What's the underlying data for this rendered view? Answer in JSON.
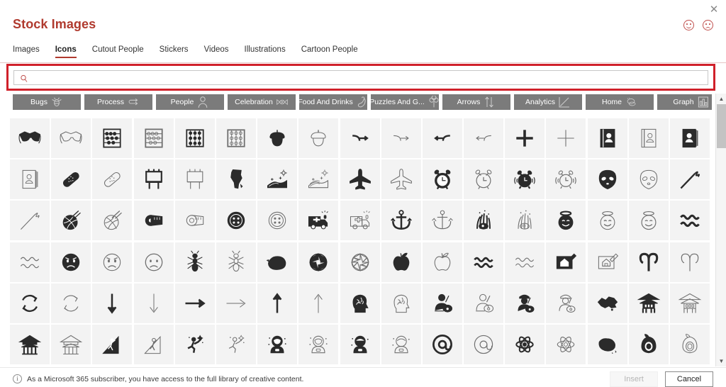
{
  "window": {
    "title": "Stock Images",
    "close_label": "✕",
    "feedback": [
      {
        "name": "smile-feedback",
        "label": "☺"
      },
      {
        "name": "frown-feedback",
        "label": "☹"
      }
    ]
  },
  "tabs": [
    {
      "label": "Images",
      "active": false
    },
    {
      "label": "Icons",
      "active": true
    },
    {
      "label": "Cutout People",
      "active": false
    },
    {
      "label": "Stickers",
      "active": false
    },
    {
      "label": "Videos",
      "active": false
    },
    {
      "label": "Illustrations",
      "active": false
    },
    {
      "label": "Cartoon People",
      "active": false
    }
  ],
  "search": {
    "value": "",
    "placeholder": "",
    "icon": "search-icon",
    "highlighted": true,
    "highlight_color": "#d0202a"
  },
  "categories": {
    "next_label": "›",
    "items": [
      {
        "label": "Bugs",
        "glyph": "bug"
      },
      {
        "label": "Process",
        "glyph": "process"
      },
      {
        "label": "People",
        "glyph": "person"
      },
      {
        "label": "Celebration",
        "glyph": "celebration"
      },
      {
        "label": "Food And Drinks",
        "glyph": "chili"
      },
      {
        "label": "Puzzles And G...",
        "glyph": "clover"
      },
      {
        "label": "Arrows",
        "glyph": "arrows"
      },
      {
        "label": "Analytics",
        "glyph": "analytics"
      },
      {
        "label": "Home",
        "glyph": "home"
      },
      {
        "label": "Graph",
        "glyph": "graph"
      }
    ]
  },
  "grid": {
    "columns": 17,
    "rows": 6,
    "icons": [
      "3d-glasses-filled",
      "3d-glasses-outline",
      "abacus-filled",
      "abacus-outline",
      "abacus-2-filled",
      "abacus-2-outline",
      "acorn-filled",
      "acorn-outline",
      "turn-right-filled",
      "turn-right-outline",
      "turn-left-filled",
      "turn-left-outline",
      "plus-filled",
      "plus-outline",
      "address-book-filled",
      "address-book-outline",
      "address-book-2-filled",
      "address-book-2-outline",
      "adhesive-bandage-filled",
      "adhesive-bandage-outline",
      "advertising-board-filled",
      "advertising-board-outline",
      "africa-filled",
      "agriculture-filled",
      "agriculture-outline",
      "airplane-filled",
      "airplane-outline",
      "alarm-clock-filled",
      "alarm-clock-outline",
      "alarm-ringing-filled",
      "alarm-ringing-outline",
      "alien-filled",
      "alien-outline",
      "needle-thread-filled",
      "needle-thread-outline",
      "yarn-ball-filled",
      "yarn-ball-outline",
      "tape-measure-filled",
      "tape-measure-outline",
      "button-filled",
      "button-outline",
      "ambulance-filled",
      "ambulance-outline",
      "anchor-filled",
      "anchor-outline",
      "anemone-filled",
      "anemone-outline",
      "angel-face-filled",
      "angel-face-outline",
      "angel-face-2-outline",
      "aquarius-filled",
      "aquarius-outline",
      "angry-face-filled",
      "angry-face-outline",
      "angry-face-2-outline",
      "ant-filled",
      "ant-outline",
      "antarctica-filled",
      "aperture-filled",
      "aperture-outline",
      "apple-filled",
      "apple-outline",
      "aquarius-2-filled",
      "aquarius-2-outline",
      "architecture-plan-filled",
      "architecture-plan-outline",
      "aries-filled",
      "aries-outline",
      "recycle-filled",
      "recycle-outline",
      "arrow-down-filled",
      "arrow-down-outline",
      "arrow-right-filled",
      "arrow-right-outline",
      "arrow-up-filled",
      "arrow-up-outline",
      "brain-head-filled",
      "brain-head-outline",
      "artist-filled",
      "artist-outline",
      "artist-2-filled",
      "artist-2-outline",
      "asia-map-filled",
      "asian-temple-filled",
      "asian-temple-outline",
      "pagoda-filled",
      "pagoda-outline",
      "climber-filled",
      "climber-outline",
      "runner-star-filled",
      "runner-star-outline",
      "astronaut-filled",
      "astronaut-outline",
      "astronaut-2-filled",
      "astronaut-2-outline",
      "at-sign-filled",
      "at-sign-outline",
      "atom-filled",
      "atom-outline",
      "australia-filled",
      "avocado-filled",
      "avocado-outline"
    ]
  },
  "scrollbar": {
    "up_label": "▲",
    "down_label": "▼"
  },
  "footer": {
    "note": "As a Microsoft 365 subscriber, you have access to the full library of creative content.",
    "info_icon": "info-icon",
    "insert_label": "Insert",
    "cancel_label": "Cancel"
  }
}
